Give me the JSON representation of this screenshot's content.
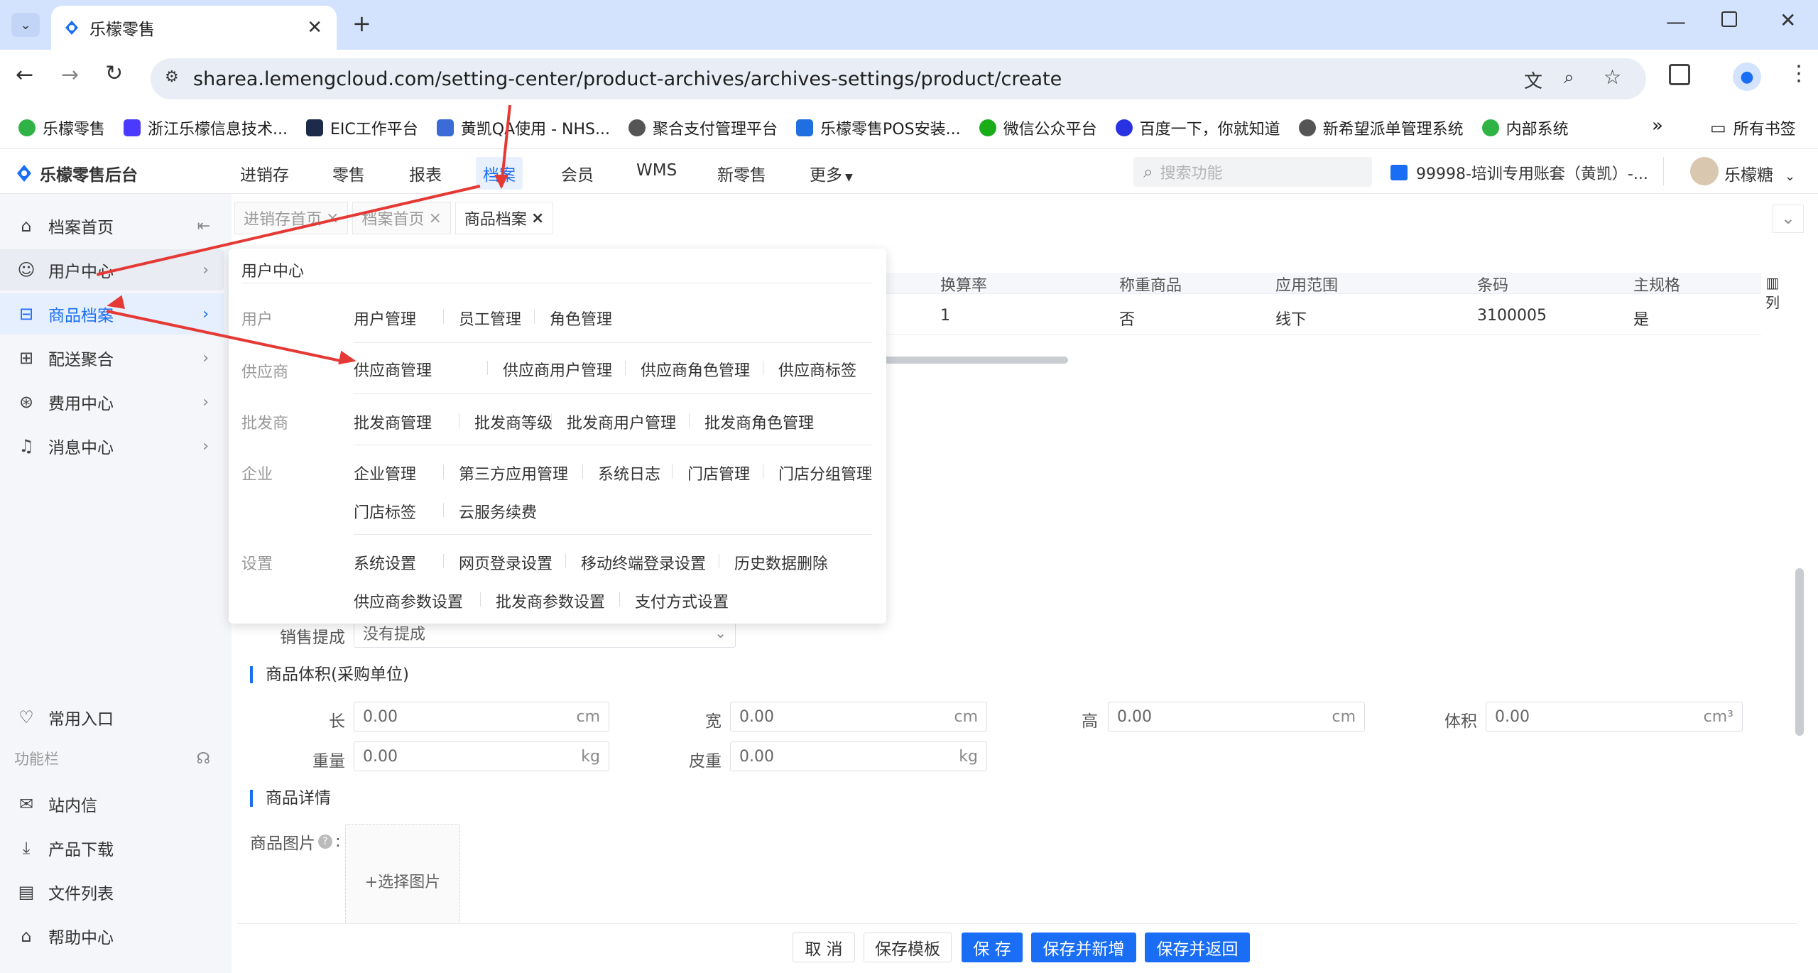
{
  "browser": {
    "tab_title": "乐檬零售",
    "url": "sharea.lemengcloud.com/setting-center/product-archives/archives-settings/product/create",
    "bookmarks": [
      "乐檬零售",
      "浙江乐檬信息技术...",
      "EIC工作平台",
      "黄凯QA使用 - NHS...",
      "聚合支付管理平台",
      "乐檬零售POS安装...",
      "微信公众平台",
      "百度一下，你就知道",
      "新希望派单管理系统",
      "内部系统"
    ],
    "all_bookmarks": "所有书签",
    "more_chevron": "»"
  },
  "app": {
    "logo": "乐檬零售后台",
    "nav": [
      "进销存",
      "零售",
      "报表",
      "档案",
      "会员",
      "WMS",
      "新零售",
      "更多"
    ],
    "search_placeholder": "搜索功能",
    "account": "99998-培训专用账套（黄凯）-...",
    "user": "乐檬糖"
  },
  "sidebar": {
    "items": [
      "档案首页",
      "用户中心",
      "商品档案",
      "配送聚合",
      "费用中心",
      "消息中心"
    ],
    "common_entry": "常用入口",
    "func_bar": "功能栏",
    "bottom": [
      "站内信",
      "产品下载",
      "文件列表",
      "帮助中心"
    ]
  },
  "page_tabs": [
    {
      "label": "进销存首页",
      "close": "×"
    },
    {
      "label": "档案首页",
      "close": "×"
    },
    {
      "label": "商品档案",
      "close": "×"
    }
  ],
  "table": {
    "headers": [
      "换算率",
      "称重商品",
      "应用范围",
      "条码",
      "主规格"
    ],
    "row": [
      "1",
      "否",
      "线下",
      "3100005",
      "是"
    ],
    "col_btn": "列"
  },
  "flyout": {
    "title": "用户中心",
    "groups": [
      {
        "cat": "用户",
        "links": [
          "用户管理",
          "员工管理",
          "角色管理"
        ]
      },
      {
        "cat": "供应商",
        "links": [
          "供应商管理",
          "供应商用户管理",
          "供应商角色管理",
          "供应商标签"
        ]
      },
      {
        "cat": "批发商",
        "links": [
          "批发商管理",
          "批发商等级",
          "批发商用户管理",
          "批发商角色管理"
        ]
      },
      {
        "cat": "企业",
        "links": [
          "企业管理",
          "第三方应用管理",
          "系统日志",
          "门店管理",
          "门店分组管理",
          "门店标签",
          "云服务续费"
        ]
      },
      {
        "cat": "设置",
        "links": [
          "系统设置",
          "网页登录设置",
          "移动终端登录设置",
          "历史数据删除",
          "供应商参数设置",
          "批发商参数设置",
          "支付方式设置"
        ]
      }
    ]
  },
  "form": {
    "commission_label": "销售提成",
    "commission_value": "没有提成",
    "volume_section": "商品体积(采购单位)",
    "fields": [
      {
        "label": "长",
        "value": "0.00",
        "unit": "cm"
      },
      {
        "label": "宽",
        "value": "0.00",
        "unit": "cm"
      },
      {
        "label": "高",
        "value": "0.00",
        "unit": "cm"
      },
      {
        "label": "体积",
        "value": "0.00",
        "unit": "cm³"
      },
      {
        "label": "重量",
        "value": "0.00",
        "unit": "kg"
      },
      {
        "label": "皮重",
        "value": "0.00",
        "unit": "kg"
      }
    ],
    "detail_section": "商品详情",
    "image_label": "商品图片",
    "image_hint": "?",
    "image_colon": ":",
    "choose_image": "+选择图片"
  },
  "buttons": [
    "取 消",
    "保存模板",
    "保 存",
    "保存并新增",
    "保存并返回"
  ],
  "colors": {
    "primary": "#1a6ef5",
    "arrow": "#e53935",
    "sidebar_bg": "#f4f6f9"
  }
}
